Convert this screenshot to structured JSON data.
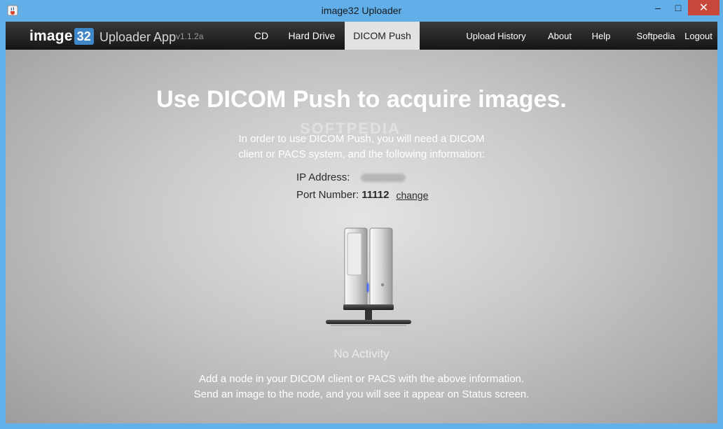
{
  "window": {
    "title": "image32 Uploader",
    "controls": {
      "minimize": "–",
      "maximize": "□",
      "close": "✕"
    }
  },
  "app": {
    "logo_text": "image",
    "logo_badge": "32",
    "name": "Uploader App",
    "version": "v1.1.2a"
  },
  "nav": {
    "tabs": [
      {
        "label": "CD",
        "active": false
      },
      {
        "label": "Hard Drive",
        "active": false
      },
      {
        "label": "DICOM Push",
        "active": true
      }
    ],
    "links": [
      "Upload History",
      "About",
      "Help",
      "Softpedia",
      "Logout"
    ]
  },
  "main": {
    "heading": "Use DICOM Push to acquire images.",
    "watermark": "SOFTPEDIA",
    "intro_line1": "In order to use DICOM Push, you will need a DICOM",
    "intro_line2": "client or PACS system, and the following information:",
    "ip_label": "IP Address:",
    "port_label": "Port Number:",
    "port_value": "11112",
    "change_label": "change",
    "status": "No Activity",
    "instruction_line1": "Add a node in your DICOM client or PACS with the above information.",
    "instruction_line2": "Send an image to the node, and you will see it appear on Status screen."
  },
  "colors": {
    "titlebar": "#61aee8",
    "close_button": "#c7473b",
    "navbar": "#1f1f1f",
    "active_tab": "#e2e2e2",
    "logo_badge": "#3f87c9",
    "server_light": "#4a6cff"
  },
  "icons": {
    "app": "java-cup-icon",
    "server": "server-icon"
  }
}
